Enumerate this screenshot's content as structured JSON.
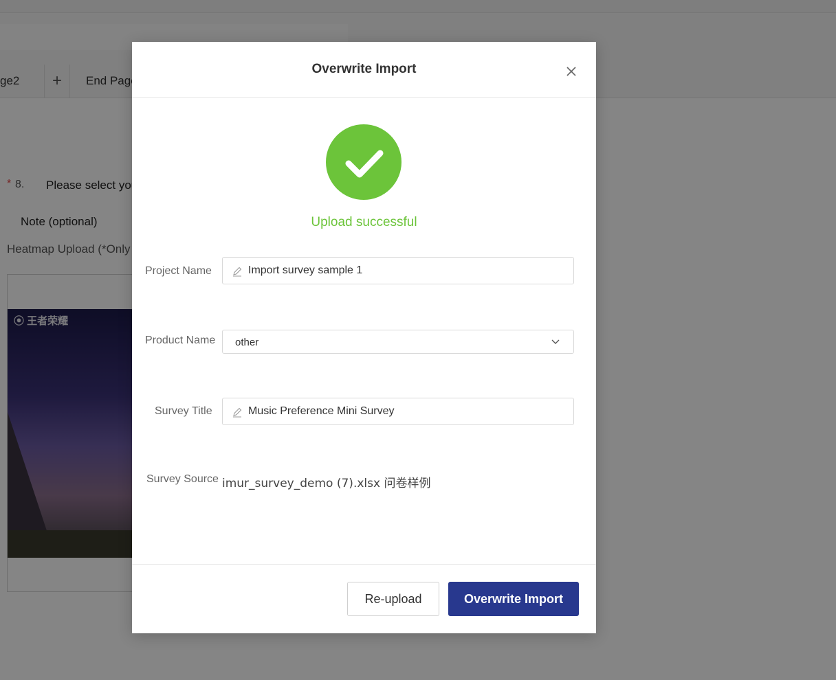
{
  "background": {
    "tabs": [
      "ge2",
      "+",
      "End Page"
    ],
    "question_number": "8.",
    "question_text": "Please select you",
    "note_label": "Note (optional)",
    "heatmap_label": "Heatmap Upload (*Only",
    "image_logo": "王者荣耀"
  },
  "modal": {
    "title": "Overwrite Import",
    "status_text": "Upload successful",
    "fields": {
      "project_name": {
        "label": "Project Name",
        "value": "Import survey sample 1"
      },
      "product_name": {
        "label": "Product Name",
        "value": "other"
      },
      "survey_title": {
        "label": "Survey Title",
        "value": "Music Preference Mini Survey"
      },
      "survey_source": {
        "label": "Survey Source",
        "value": "imur_survey_demo (7).xlsx 问卷样例"
      }
    },
    "buttons": {
      "reupload": "Re-upload",
      "overwrite": "Overwrite Import"
    }
  },
  "colors": {
    "success": "#6cc43a",
    "primary": "#28388e",
    "required": "#e23c3c"
  },
  "icons": [
    "close-icon",
    "check-icon",
    "pen-icon",
    "chevron-down-icon"
  ]
}
